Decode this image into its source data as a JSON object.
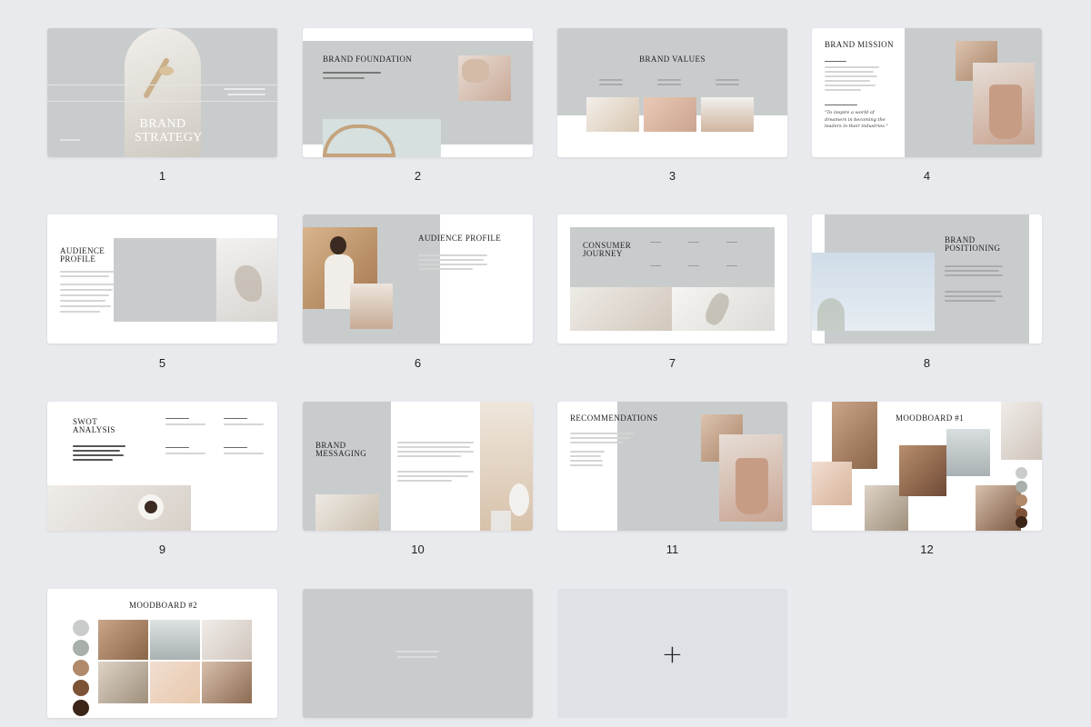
{
  "slides": [
    {
      "number": "1",
      "title_line1": "BRAND",
      "title_line2": "STRATEGY"
    },
    {
      "number": "2",
      "title": "BRAND FOUNDATION"
    },
    {
      "number": "3",
      "title": "BRAND VALUES"
    },
    {
      "number": "4",
      "title": "BRAND MISSION",
      "quote": "\"To inspire a world of dreamers in becoming the leaders in their industries.\""
    },
    {
      "number": "5",
      "title_line1": "AUDIENCE",
      "title_line2": "PROFILE"
    },
    {
      "number": "6",
      "title": "AUDIENCE PROFILE"
    },
    {
      "number": "7",
      "title_line1": "CONSUMER",
      "title_line2": "JOURNEY"
    },
    {
      "number": "8",
      "title_line1": "BRAND",
      "title_line2": "POSITIONING"
    },
    {
      "number": "9",
      "title_line1": "SWOT",
      "title_line2": "ANALYSIS"
    },
    {
      "number": "10",
      "title_line1": "BRAND",
      "title_line2": "MESSAGING"
    },
    {
      "number": "11",
      "title": "RECOMMENDATIONS"
    },
    {
      "number": "12",
      "title": "MOODBOARD #1"
    },
    {
      "number": "",
      "title": "MOODBOARD #2"
    },
    {
      "number": ""
    },
    {
      "number": "",
      "add_label": "+"
    }
  ],
  "colors": {
    "background": "#e9eaee",
    "slide_gray": "#c9cccd",
    "add_tile": "#dfe1e6"
  }
}
